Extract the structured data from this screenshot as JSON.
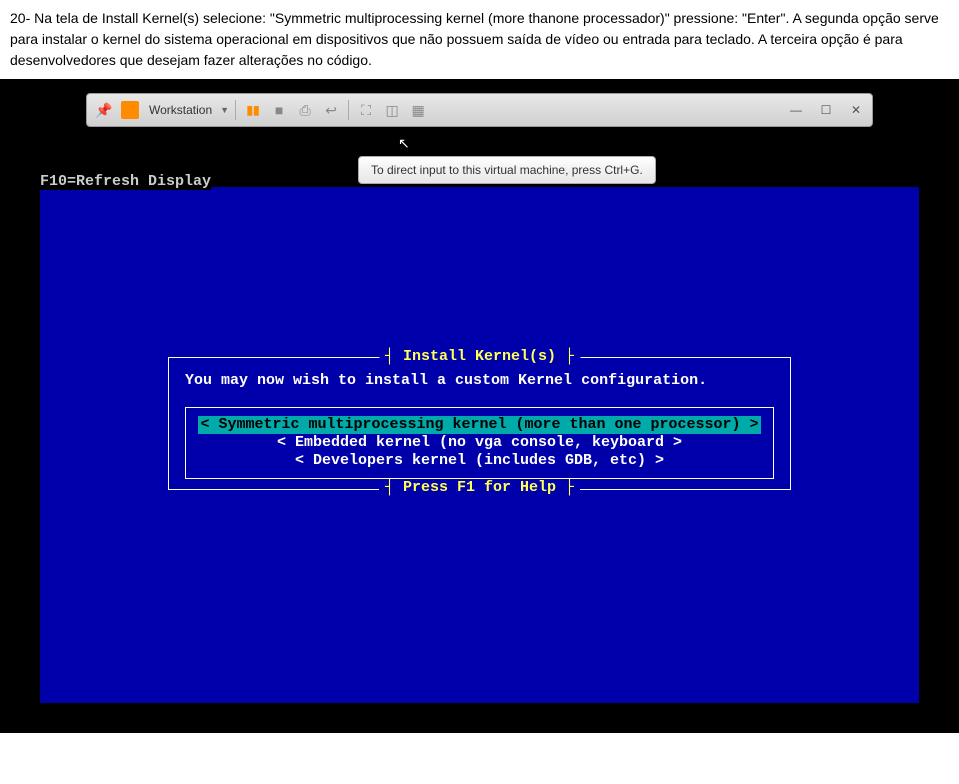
{
  "description": {
    "line1_prefix": "20- Na tela de Install Kernel(s) selecione: \"Symmetric multiprocessing kernel (more thanone processador)\" pressione: \"Enter\". A segunda opção serve para instalar o kernel do sistema operacional em dispositivos que não possuem saída de vídeo ou entrada para teclado. A terceira opção é para desenvolvedores que desejam fazer alterações no código."
  },
  "toolbar": {
    "workstation_label": "Workstation"
  },
  "tooltip": {
    "text": "To direct input to this virtual machine, press Ctrl+G."
  },
  "console": {
    "refresh_label": "F10=Refresh Display",
    "dialog_title": "Install Kernel(s)",
    "instruction": "You may now wish to install a custom Kernel configuration.",
    "options": {
      "selected": "< Symmetric multiprocessing kernel (more than one processor) >",
      "opt2": "< Embedded kernel (no vga console, keyboard >",
      "opt3": "< Developers kernel (includes GDB, etc) >"
    },
    "help": "Press F1 for Help"
  }
}
